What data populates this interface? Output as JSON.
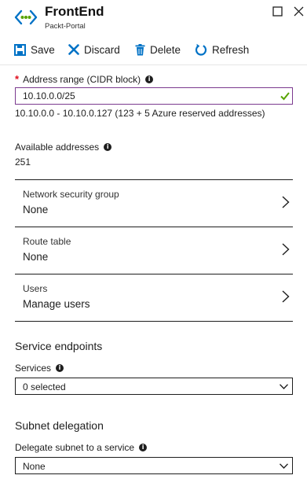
{
  "header": {
    "title": "FrontEnd",
    "subtitle": "Packt-Portal",
    "icon": "subnet-icon",
    "window_icons": [
      "maximize-icon",
      "close-icon"
    ]
  },
  "toolbar": {
    "save_label": "Save",
    "discard_label": "Discard",
    "delete_label": "Delete",
    "refresh_label": "Refresh"
  },
  "address_range": {
    "required_marker": "*",
    "label": "Address range (CIDR block)",
    "value": "10.10.0.0/25",
    "range_hint": "10.10.0.0 - 10.10.0.127 (123 + 5 Azure reserved addresses)"
  },
  "available": {
    "label": "Available addresses",
    "value": "251"
  },
  "rows": [
    {
      "label": "Network security group",
      "value": "None"
    },
    {
      "label": "Route table",
      "value": "None"
    },
    {
      "label": "Users",
      "value": "Manage users"
    }
  ],
  "service_endpoints": {
    "heading": "Service endpoints",
    "services_label": "Services",
    "services_value": "0 selected"
  },
  "subnet_delegation": {
    "heading": "Subnet delegation",
    "delegate_label": "Delegate subnet to a service",
    "delegate_value": "None"
  },
  "colors": {
    "accent_blue": "#0072c6",
    "success_green": "#57a300",
    "required_red": "#e00b1c",
    "focus_border": "#7b3a8f"
  }
}
